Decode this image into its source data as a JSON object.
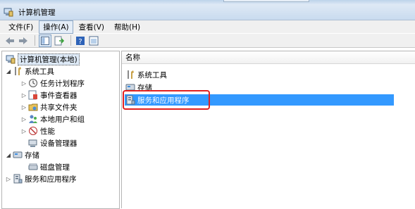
{
  "window": {
    "title": "计算机管理"
  },
  "menu": [
    "文件(F)",
    "操作(A)",
    "查看(V)",
    "帮助(H)"
  ],
  "menu_active_index": 1,
  "toolbar": {
    "buttons": [
      "back-arrow-icon",
      "forward-arrow-icon",
      "show-tree-icon",
      "export-list-icon",
      "help-icon",
      "properties-icon"
    ]
  },
  "tree": {
    "root": "计算机管理(本地)",
    "system_tools": "系统工具",
    "task_scheduler": "任务计划程序",
    "event_viewer": "事件查看器",
    "shared_folders": "共享文件夹",
    "local_users_groups": "本地用户和组",
    "performance": "性能",
    "device_manager": "设备管理器",
    "storage": "存储",
    "disk_management": "磁盘管理",
    "services_apps": "服务和应用程序"
  },
  "list": {
    "header": "名称",
    "items": [
      "系统工具",
      "存储",
      "服务和应用程序"
    ],
    "selected_index": 2
  },
  "colors": {
    "selection": "#3399ff",
    "highlight_box": "#e02020"
  }
}
